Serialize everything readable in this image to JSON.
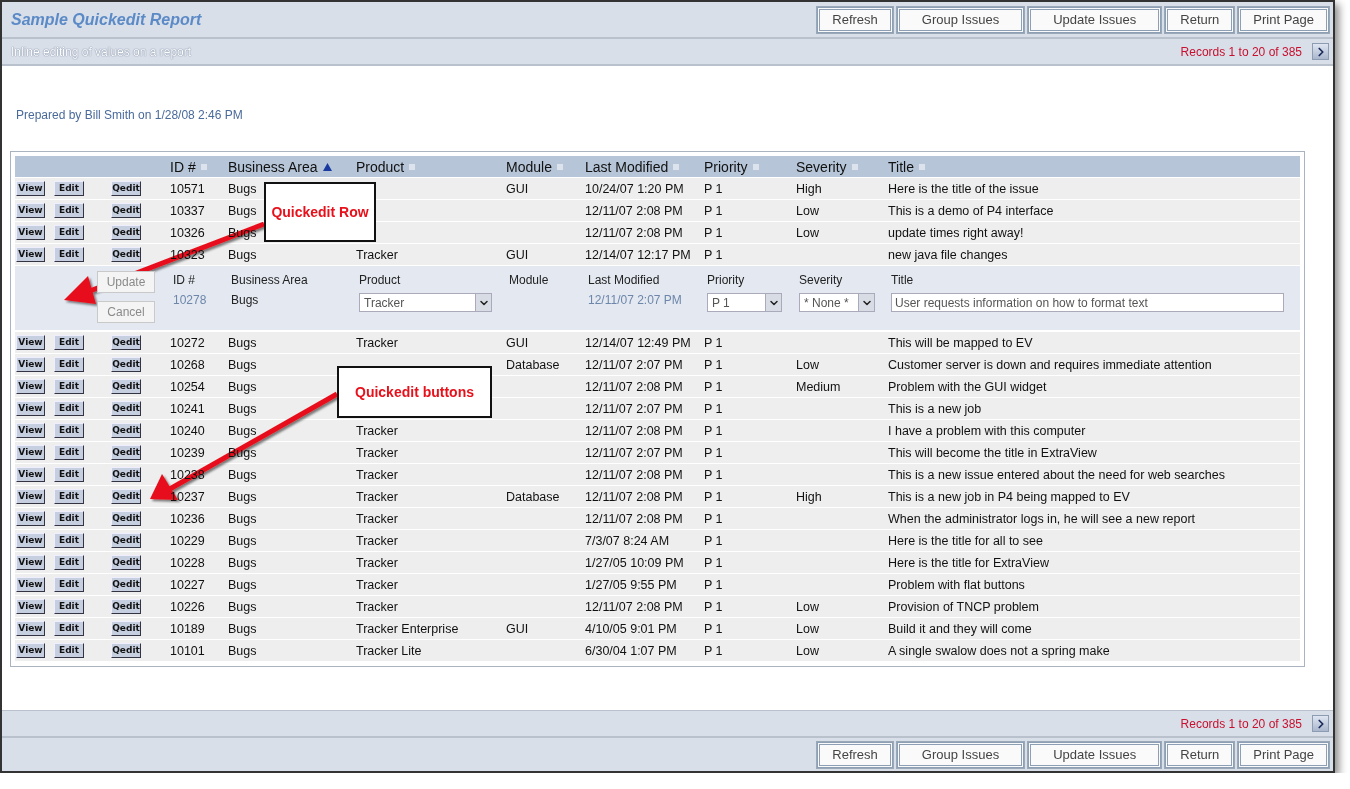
{
  "header": {
    "title": "Sample Quickedit Report",
    "subtitle": "Inline editing of values on a report"
  },
  "top_buttons": [
    "Refresh",
    "Group Issues",
    "Update Issues",
    "Return",
    "Print Page"
  ],
  "records_top": "Records 1 to 20 of 385",
  "prepared": "Prepared by Bill Smith on 1/28/08 2:46 PM",
  "table": {
    "columns": [
      {
        "label": "ID #",
        "sorted": false
      },
      {
        "label": "Business Area",
        "sorted": true
      },
      {
        "label": "Product",
        "sorted": false
      },
      {
        "label": "Module",
        "sorted": false
      },
      {
        "label": "Last Modified",
        "sorted": false
      },
      {
        "label": "Priority",
        "sorted": false
      },
      {
        "label": "Severity",
        "sorted": false
      },
      {
        "label": "Title",
        "sorted": false
      }
    ],
    "rows": [
      {
        "kind": "row",
        "buttons": [
          "View",
          "Edit",
          "Qedit"
        ],
        "cells": [
          "10571",
          "Bugs",
          "",
          "GUI",
          "10/24/07 1:20 PM",
          "P 1",
          "High",
          "Here is the title of the issue"
        ]
      },
      {
        "kind": "row",
        "buttons": [
          "View",
          "Edit",
          "Qedit"
        ],
        "cells": [
          "10337",
          "Bugs",
          "",
          "",
          "12/11/07 2:08 PM",
          "P 1",
          "Low",
          "This is a demo of P4 interface"
        ]
      },
      {
        "kind": "row",
        "buttons": [
          "View",
          "Edit",
          "Qedit"
        ],
        "cells": [
          "10326",
          "Bugs",
          "",
          "",
          "12/11/07 2:08 PM",
          "P 1",
          "Low",
          "update times right away!"
        ]
      },
      {
        "kind": "row",
        "buttons": [
          "View",
          "Edit",
          "Qedit"
        ],
        "cells": [
          "10323",
          "Bugs",
          "Tracker",
          "GUI",
          "12/14/07 12:17 PM",
          "P 1",
          "",
          "new java file changes"
        ]
      },
      {
        "kind": "quickedit",
        "buttons": [
          {
            "label": "Update",
            "disabled": true
          },
          {
            "label": "Cancel",
            "disabled": true
          }
        ],
        "fields": [
          {
            "label": "ID #",
            "kind": "muted",
            "value": "10278"
          },
          {
            "label": "Business Area",
            "kind": "text",
            "value": "Bugs"
          },
          {
            "label": "Product",
            "kind": "select",
            "value": "Tracker"
          },
          {
            "label": "Module",
            "kind": "none"
          },
          {
            "label": "Last Modified",
            "kind": "muted",
            "value": "12/11/07 2:07 PM"
          },
          {
            "label": "Priority",
            "kind": "select",
            "value": "P 1"
          },
          {
            "label": "Severity",
            "kind": "select",
            "value": "* None *"
          },
          {
            "label": "Title",
            "kind": "input",
            "value": "User requests information on how to format text"
          }
        ]
      },
      {
        "kind": "row",
        "buttons": [
          "View",
          "Edit",
          "Qedit"
        ],
        "cells": [
          "10272",
          "Bugs",
          "Tracker",
          "GUI",
          "12/14/07 12:49 PM",
          "P 1",
          "",
          "This will be mapped to EV"
        ]
      },
      {
        "kind": "row",
        "buttons": [
          "View",
          "Edit",
          "Qedit"
        ],
        "cells": [
          "10268",
          "Bugs",
          "",
          "Database",
          "12/11/07 2:07 PM",
          "P 1",
          "Low",
          "Customer server is down and requires immediate attention"
        ]
      },
      {
        "kind": "row",
        "buttons": [
          "View",
          "Edit",
          "Qedit"
        ],
        "cells": [
          "10254",
          "Bugs",
          "",
          "",
          "12/11/07 2:08 PM",
          "P 1",
          "Medium",
          "Problem with the GUI widget"
        ]
      },
      {
        "kind": "row",
        "buttons": [
          "View",
          "Edit",
          "Qedit"
        ],
        "cells": [
          "10241",
          "Bugs",
          "",
          "",
          "12/11/07 2:07 PM",
          "P 1",
          "",
          "This is a new job"
        ]
      },
      {
        "kind": "row",
        "buttons": [
          "View",
          "Edit",
          "Qedit"
        ],
        "cells": [
          "10240",
          "Bugs",
          "Tracker",
          "",
          "12/11/07 2:08 PM",
          "P 1",
          "",
          "I have a problem with this computer"
        ]
      },
      {
        "kind": "row",
        "buttons": [
          "View",
          "Edit",
          "Qedit"
        ],
        "cells": [
          "10239",
          "Bugs",
          "Tracker",
          "",
          "12/11/07 2:07 PM",
          "P 1",
          "",
          "This will become the title in ExtraView"
        ]
      },
      {
        "kind": "row",
        "buttons": [
          "View",
          "Edit",
          "Qedit"
        ],
        "cells": [
          "10238",
          "Bugs",
          "Tracker",
          "",
          "12/11/07 2:08 PM",
          "P 1",
          "",
          "This is a new issue entered about the need for web searches"
        ]
      },
      {
        "kind": "row",
        "buttons": [
          "View",
          "Edit",
          "Qedit"
        ],
        "cells": [
          "10237",
          "Bugs",
          "Tracker",
          "Database",
          "12/11/07 2:08 PM",
          "P 1",
          "High",
          "This is a new job in P4 being mapped to EV"
        ]
      },
      {
        "kind": "row",
        "buttons": [
          "View",
          "Edit",
          "Qedit"
        ],
        "cells": [
          "10236",
          "Bugs",
          "Tracker",
          "",
          "12/11/07 2:08 PM",
          "P 1",
          "",
          "When the administrator logs in, he will see a new report"
        ]
      },
      {
        "kind": "row",
        "buttons": [
          "View",
          "Edit",
          "Qedit"
        ],
        "cells": [
          "10229",
          "Bugs",
          "Tracker",
          "",
          "7/3/07 8:24 AM",
          "P 1",
          "",
          "Here is the title for all to see"
        ]
      },
      {
        "kind": "row",
        "buttons": [
          "View",
          "Edit",
          "Qedit"
        ],
        "cells": [
          "10228",
          "Bugs",
          "Tracker",
          "",
          "1/27/05 10:09 PM",
          "P 1",
          "",
          "Here is the title for ExtraView"
        ]
      },
      {
        "kind": "row",
        "buttons": [
          "View",
          "Edit",
          "Qedit"
        ],
        "cells": [
          "10227",
          "Bugs",
          "Tracker",
          "",
          "1/27/05 9:55 PM",
          "P 1",
          "",
          "Problem with flat buttons"
        ]
      },
      {
        "kind": "row",
        "buttons": [
          "View",
          "Edit",
          "Qedit"
        ],
        "cells": [
          "10226",
          "Bugs",
          "Tracker",
          "",
          "12/11/07 2:08 PM",
          "P 1",
          "Low",
          "Provision of TNCP problem"
        ]
      },
      {
        "kind": "row",
        "buttons": [
          "View",
          "Edit",
          "Qedit"
        ],
        "cells": [
          "10189",
          "Bugs",
          "Tracker Enterprise",
          "GUI",
          "4/10/05 9:01 PM",
          "P 1",
          "Low",
          "Build it and they will come"
        ]
      },
      {
        "kind": "row",
        "buttons": [
          "View",
          "Edit",
          "Qedit"
        ],
        "cells": [
          "10101",
          "Bugs",
          "Tracker Lite",
          "",
          "6/30/04 1:07 PM",
          "P 1",
          "Low",
          "A single swalow does not a spring make"
        ]
      }
    ]
  },
  "records_bottom": "Records 1 to 20 of 385",
  "bottom_buttons": [
    "Refresh",
    "Group Issues",
    "Update Issues",
    "Return",
    "Print Page"
  ],
  "annotations": [
    {
      "text": "Quickedit Row"
    },
    {
      "text": "Quickedit buttons"
    }
  ]
}
